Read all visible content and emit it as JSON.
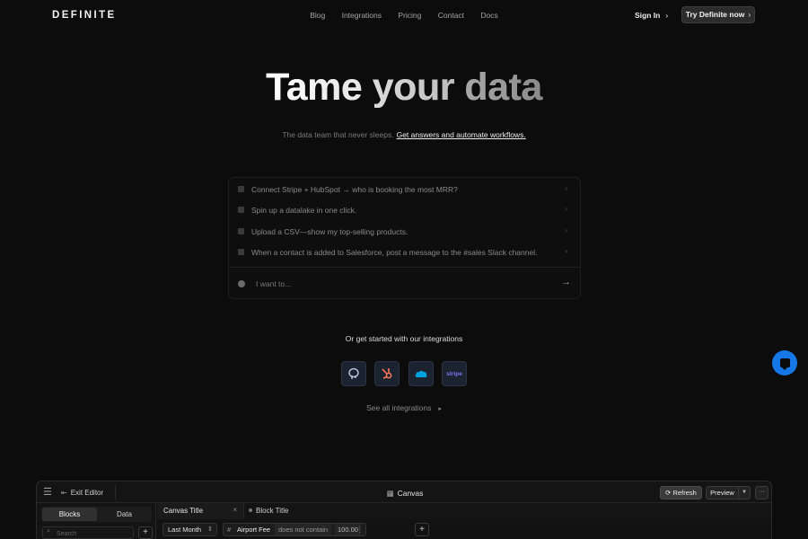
{
  "nav": {
    "logo": "DEFINITE",
    "links": [
      "Blog",
      "Integrations",
      "Pricing",
      "Contact",
      "Docs"
    ],
    "sign_in": "Sign In",
    "cta": "Try Definite now"
  },
  "hero": {
    "title_words": [
      "Tame",
      "your",
      "data"
    ],
    "subtitle": "The data team that never sleeps.",
    "subtitle_link": "Get answers and automate workflows."
  },
  "prompt": {
    "suggestions": [
      "Connect Stripe + HubSpot → who is booking the most MRR?",
      "Spin up a datalake in one click.",
      "Upload a CSV—show my top-selling products.",
      "When a contact is added to Salesforce, post a message to the #sales Slack channel."
    ],
    "placeholder": "I want to..."
  },
  "integrations": {
    "heading": "Or get started with our integrations",
    "items": [
      {
        "name": "postgres-icon",
        "color": "#b9c6e0"
      },
      {
        "name": "hubspot-icon",
        "color": "#ff7a59"
      },
      {
        "name": "salesforce-icon",
        "color": "#00a1e0"
      },
      {
        "name": "stripe-icon",
        "color": "#7b74f0",
        "label": "stripe"
      }
    ],
    "see_all": "See all integrations"
  },
  "editor": {
    "exit": "Exit Editor",
    "canvas": "Canvas",
    "refresh": "Refresh",
    "preview": "Preview",
    "sidebar_tabs": [
      "Blocks",
      "Data"
    ],
    "search_placeholder": "Search",
    "canvas_tab": "Canvas Title",
    "block_tab": "Block Title",
    "filter": {
      "period": "Last Month",
      "field": "Airport Fee",
      "operator": "does not contain",
      "value": "100.00"
    }
  },
  "colors": {
    "background": "#0c0c0c",
    "chat_button": "#1677e6"
  }
}
